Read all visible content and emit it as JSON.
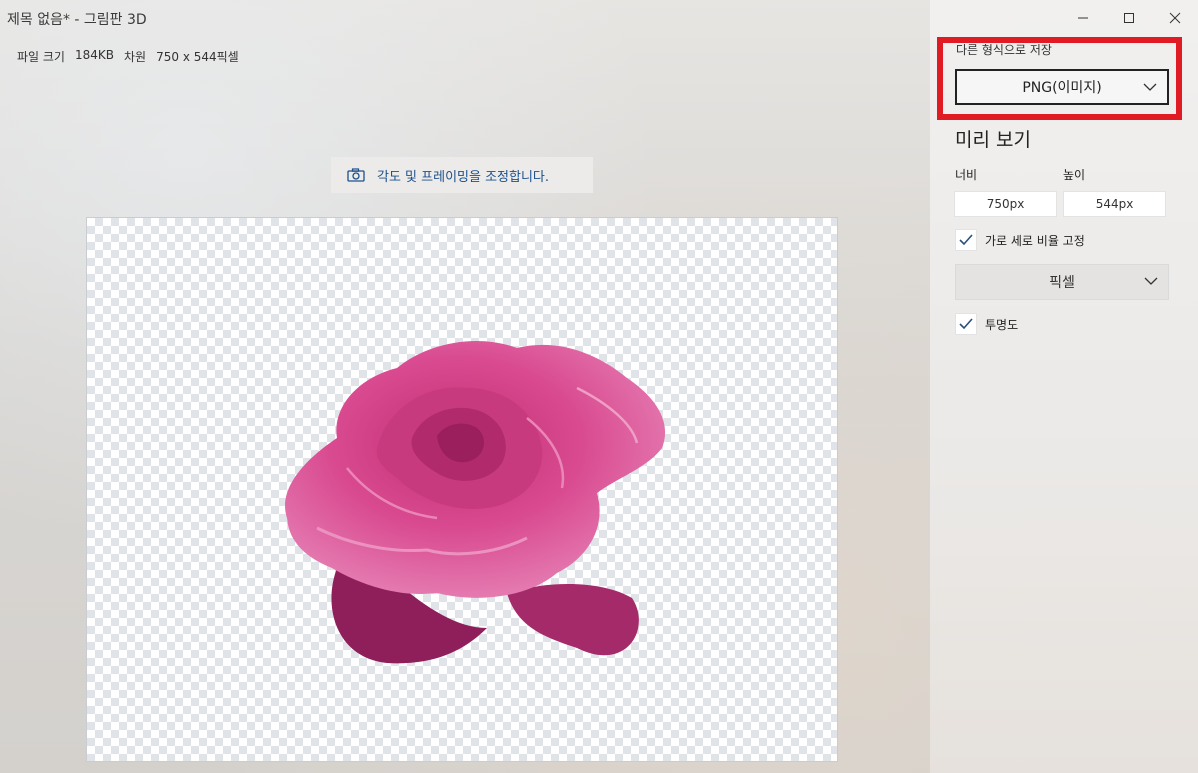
{
  "window": {
    "title": "제목 없음* - 그림판 3D"
  },
  "file_info": {
    "size_label": "파일 크기",
    "size_value": "184KB",
    "dim_label": "차원",
    "dim_value": "750 x 544픽셀"
  },
  "canvas_toolbar": {
    "adjust_label": "각도 및 프레이밍을 조정합니다."
  },
  "panel": {
    "format_label": "다른 형식으로 저장",
    "format_value": "PNG(이미지)",
    "preview_title": "미리 보기",
    "width_label": "너비",
    "height_label": "높이",
    "width_value": "750px",
    "height_value": "544px",
    "lock_ratio_label": "가로 세로 비율 고정",
    "lock_ratio_checked": true,
    "unit_value": "픽셀",
    "transparency_label": "투명도",
    "transparency_checked": true
  },
  "colors": {
    "highlight": "#e01b24",
    "accent_text": "#1c4f8c",
    "rose_main": "#d9488e",
    "rose_dark": "#8e1f5a"
  },
  "icons": [
    "camera-icon",
    "minimize-icon",
    "maximize-icon",
    "close-icon",
    "chevron-down-icon",
    "checkmark-icon"
  ]
}
